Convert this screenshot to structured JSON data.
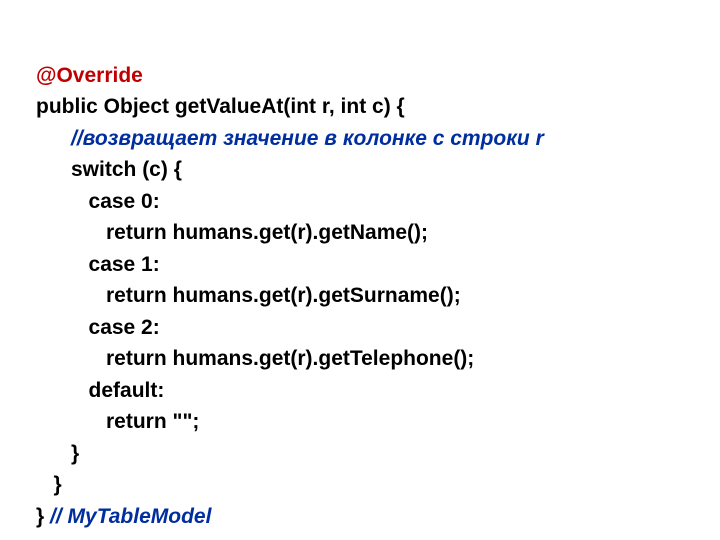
{
  "code": {
    "line1": "@Override",
    "line2": "public Object getValueAt(int r, int c) {",
    "line3": "      //возвращает значение в колонке c строки r",
    "line4": "      switch (c) {",
    "line5": "         case 0:",
    "line6": "            return humans.get(r).getName();",
    "line7": "         case 1:",
    "line8": "            return humans.get(r).getSurname();",
    "line9": "         case 2:",
    "line10": "            return humans.get(r).getTelephone();",
    "line11": "         default:",
    "line12": "            return \"\";",
    "line13": "      }",
    "line14": "   }",
    "line15a": "} ",
    "line15b": "// MyTableModel"
  }
}
